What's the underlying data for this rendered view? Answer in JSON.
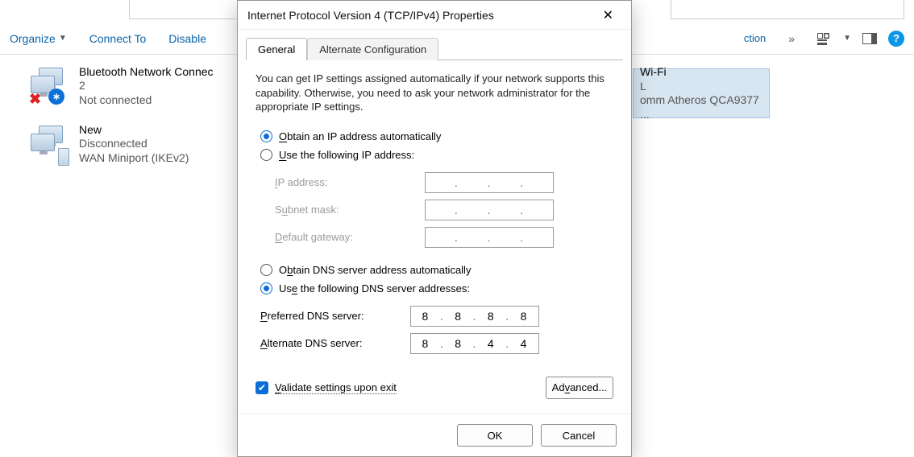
{
  "toolbar": {
    "organize": "Organize",
    "connect_to": "Connect To",
    "disable": "Disable"
  },
  "connections": {
    "bt": {
      "name": "Bluetooth Network Connec",
      "line2": "2",
      "status": "Not connected"
    },
    "new": {
      "name": "New",
      "status": "Disconnected",
      "driver": "WAN Miniport (IKEv2)"
    },
    "wifi": {
      "name": "Wi-Fi",
      "line2": "L",
      "driver": "omm Atheros QCA9377 ..."
    }
  },
  "cutoff_text": "ction",
  "dialog": {
    "title": "Internet Protocol Version 4 (TCP/IPv4) Properties",
    "tabs": {
      "general": "General",
      "alt": "Alternate Configuration"
    },
    "intro": "You can get IP settings assigned automatically if your network supports this capability. Otherwise, you need to ask your network administrator for the appropriate IP settings.",
    "radio_ip_auto": "btain an IP address automatically",
    "radio_ip_auto_u": "O",
    "radio_ip_manual": "se the following IP address:",
    "radio_ip_manual_u": "U",
    "ip_label_pre": "I",
    "ip_label": "P address:",
    "subnet_label_pre": "S",
    "subnet_label": "bnet mask:",
    "subnet_label_u": "u",
    "gateway_label_pre": "D",
    "gateway_label": "efault gateway:",
    "radio_dns_auto": "tain DNS server address automatically",
    "radio_dns_auto_u": "b",
    "radio_dns_auto_pre": "O",
    "radio_dns_manual": " the following DNS server addresses:",
    "radio_dns_manual_u": "e",
    "radio_dns_manual_pre": "Us",
    "pref_dns_label": "referred DNS server:",
    "pref_dns_u": "P",
    "alt_dns_label": "lternate DNS server:",
    "alt_dns_u": "A",
    "pref_dns": [
      "8",
      "8",
      "8",
      "8"
    ],
    "alt_dns": [
      "8",
      "8",
      "4",
      "4"
    ],
    "validate": "alidate settings upon exit",
    "validate_u": "V",
    "advanced": "Ad",
    "advanced_u": "v",
    "advanced_post": "anced...",
    "ok": "OK",
    "cancel": "Cancel"
  }
}
